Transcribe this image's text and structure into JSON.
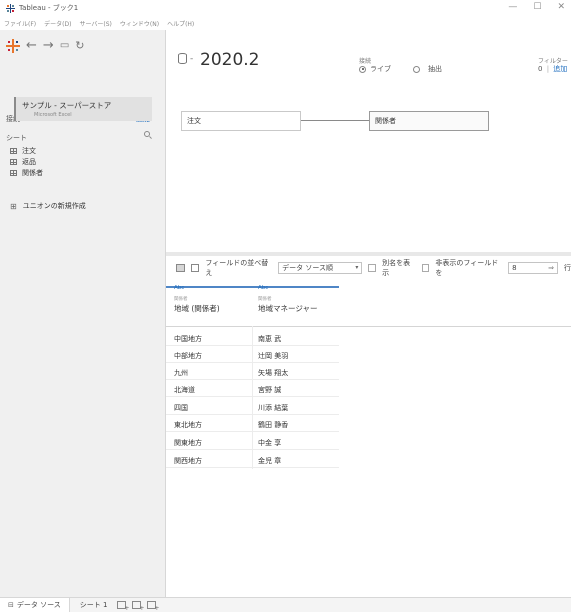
{
  "window": {
    "title": "Tableau - ブック1",
    "controls": [
      "—",
      "☐",
      "✕"
    ]
  },
  "menu": [
    "ファイル(F)",
    "データ(D)",
    "サーバー(S)",
    "ウィンドウ(N)",
    "ヘルプ(H)"
  ],
  "left": {
    "connections_label": "接続",
    "add_label": "追加",
    "connection": {
      "name": "サンプル - スーパーストア",
      "type": "Microsoft Excel"
    },
    "sheets_label": "シート",
    "sheets": [
      "注文",
      "返品",
      "関係者"
    ],
    "new_union": "ユニオンの新規作成"
  },
  "header": {
    "datasource_name": "2020.2",
    "connection_label": "接続",
    "live_label": "ライブ",
    "extract_label": "抽出",
    "filters_label": "フィルター",
    "filters_count": "0",
    "filters_separator": "|",
    "filters_add": "追加"
  },
  "canvas": {
    "left_table": "注文",
    "right_table": "関係者"
  },
  "grid_toolbar": {
    "sort_label": "フィールドの並べ替え",
    "sort_value": "データ ソース順",
    "show_alias": "別名を表示",
    "show_hidden": "非表示のフィールドを",
    "rows_value": "8",
    "rows_label": "行"
  },
  "columns": [
    {
      "type": "Abc",
      "source": "関係者",
      "name": "地域 (関係者)"
    },
    {
      "type": "Abc",
      "source": "関係者",
      "name": "地域マネージャー"
    }
  ],
  "rows": [
    [
      "中国地方",
      "南恵 武"
    ],
    [
      "中部地方",
      "辻岡 美羽"
    ],
    [
      "九州",
      "矢場 翔太"
    ],
    [
      "北海道",
      "宮野 誠"
    ],
    [
      "四国",
      "川添 結葉"
    ],
    [
      "東北地方",
      "鶴田 静香"
    ],
    [
      "関東地方",
      "中金 享"
    ],
    [
      "関西地方",
      "金児 章"
    ]
  ],
  "bottom": {
    "datasource_tab": "データ ソース",
    "sheet_tab": "シート 1"
  },
  "colors": {
    "accent": "#1f6ebf",
    "logo": [
      "#e8762d",
      "#c72037",
      "#5b879b",
      "#1f457e"
    ]
  }
}
